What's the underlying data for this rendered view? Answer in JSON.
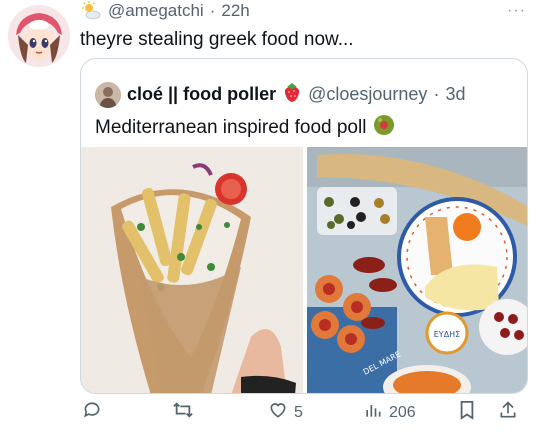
{
  "tweet": {
    "handle": "@amegatchi",
    "separator": "·",
    "time": "22h",
    "text": "theyre stealing greek food now...",
    "more_icon": "more-dots-icon"
  },
  "quote": {
    "display_name": "cloé || food poller",
    "handle": "@cloesjourney",
    "separator": "·",
    "time": "3d",
    "text": "Mediterranean inspired food poll",
    "package_label": "ΕΥΔΗΣ",
    "table_label": "DEL MARE"
  },
  "actions": {
    "reply_count": "",
    "retweet_count": "",
    "like_count": "5",
    "views_count": "206"
  },
  "colors": {
    "text_primary": "#0f1419",
    "text_secondary": "#536471",
    "border": "#cfd9de"
  }
}
